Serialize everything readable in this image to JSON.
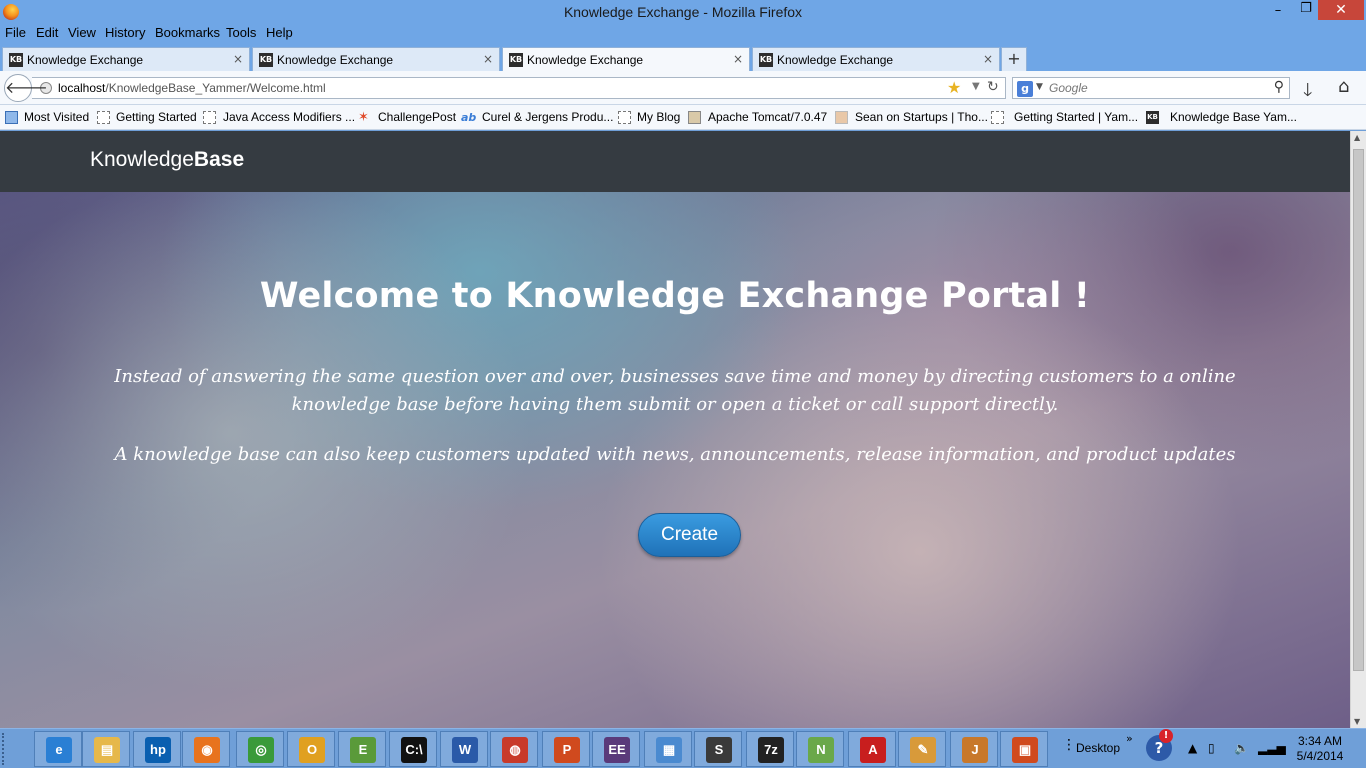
{
  "window": {
    "title": "Knowledge Exchange - Mozilla Firefox",
    "minimize": "–",
    "maximize": "❐",
    "close": "✕"
  },
  "menu": [
    "File",
    "Edit",
    "View",
    "History",
    "Bookmarks",
    "Tools",
    "Help"
  ],
  "tabs": [
    {
      "label": "Knowledge Exchange",
      "favicon": "KB",
      "close": "×"
    },
    {
      "label": "Knowledge Exchange",
      "favicon": "KB",
      "close": "×"
    },
    {
      "label": "Knowledge Exchange",
      "favicon": "KB",
      "close": "×",
      "active": true
    },
    {
      "label": "Knowledge Exchange",
      "favicon": "KB",
      "close": "×"
    }
  ],
  "new_tab": "+",
  "navigation": {
    "url_host": "localhost",
    "url_path": "/KnowledgeBase_Yammer/Welcome.html",
    "search_placeholder": "Google",
    "search_engine_letter": "g"
  },
  "bookmarks": [
    {
      "label": "Most Visited",
      "icon": "blue"
    },
    {
      "label": "Getting Started",
      "icon": "page"
    },
    {
      "label": "Java Access Modifiers ...",
      "icon": "page"
    },
    {
      "label": "ChallengePost",
      "icon": "star"
    },
    {
      "label": "Curel & Jergens Produ...",
      "icon": "ab"
    },
    {
      "label": "My Blog",
      "icon": "page"
    },
    {
      "label": "Apache Tomcat/7.0.47",
      "icon": "img"
    },
    {
      "label": "Sean on Startups | Tho...",
      "icon": "face"
    },
    {
      "label": "Getting Started | Yam...",
      "icon": "page"
    },
    {
      "label": "Knowledge Base Yam...",
      "icon": "kb"
    }
  ],
  "site": {
    "brand_regular": "Knowledge",
    "brand_bold": "Base",
    "hero_title": "Welcome to Knowledge Exchange Portal !",
    "hero_paragraph_1": "Instead of answering the same question over and over, businesses save time and money by directing customers to a online knowledge base before having them submit or open a ticket or call support directly.",
    "hero_paragraph_2": "A knowledge base can also keep customers updated with news, announcements, release information, and product updates",
    "create_button": "Create"
  },
  "taskbar": {
    "apps": [
      {
        "name": "internet-explorer",
        "glyph": "e",
        "color": "#2a7fd4"
      },
      {
        "name": "file-explorer",
        "glyph": "▤",
        "color": "#e6b84a"
      },
      {
        "name": "hp",
        "glyph": "hp",
        "color": "#0a5fb0"
      },
      {
        "name": "firefox",
        "glyph": "◉",
        "color": "#e8731e"
      },
      {
        "name": "chrome",
        "glyph": "◎",
        "color": "#3a9a3a"
      },
      {
        "name": "outlook",
        "glyph": "O",
        "color": "#e0a020"
      },
      {
        "name": "evernote",
        "glyph": "E",
        "color": "#5a9a3a"
      },
      {
        "name": "command-prompt",
        "glyph": "C:\\",
        "color": "#111111"
      },
      {
        "name": "word",
        "glyph": "W",
        "color": "#2a5aa8"
      },
      {
        "name": "media-player",
        "glyph": "◍",
        "color": "#c83a2a"
      },
      {
        "name": "powerpoint",
        "glyph": "P",
        "color": "#d04a1e"
      },
      {
        "name": "java-ee-ide",
        "glyph": "EE",
        "color": "#5a3a7a"
      },
      {
        "name": "control-panel",
        "glyph": "▦",
        "color": "#4a8ad0"
      },
      {
        "name": "sublime-text",
        "glyph": "S",
        "color": "#3a3a3a"
      },
      {
        "name": "7zip",
        "glyph": "7z",
        "color": "#222222"
      },
      {
        "name": "notepad-plus",
        "glyph": "N",
        "color": "#6aa84a"
      },
      {
        "name": "acrobat",
        "glyph": "A",
        "color": "#c81e1e"
      },
      {
        "name": "paint",
        "glyph": "✎",
        "color": "#d89a3a"
      },
      {
        "name": "java",
        "glyph": "J",
        "color": "#c8782a"
      },
      {
        "name": "remote-desktop",
        "glyph": "▣",
        "color": "#d04a1e"
      }
    ],
    "desktop_label": "Desktop",
    "time": "3:34 AM",
    "date": "5/4/2014"
  }
}
